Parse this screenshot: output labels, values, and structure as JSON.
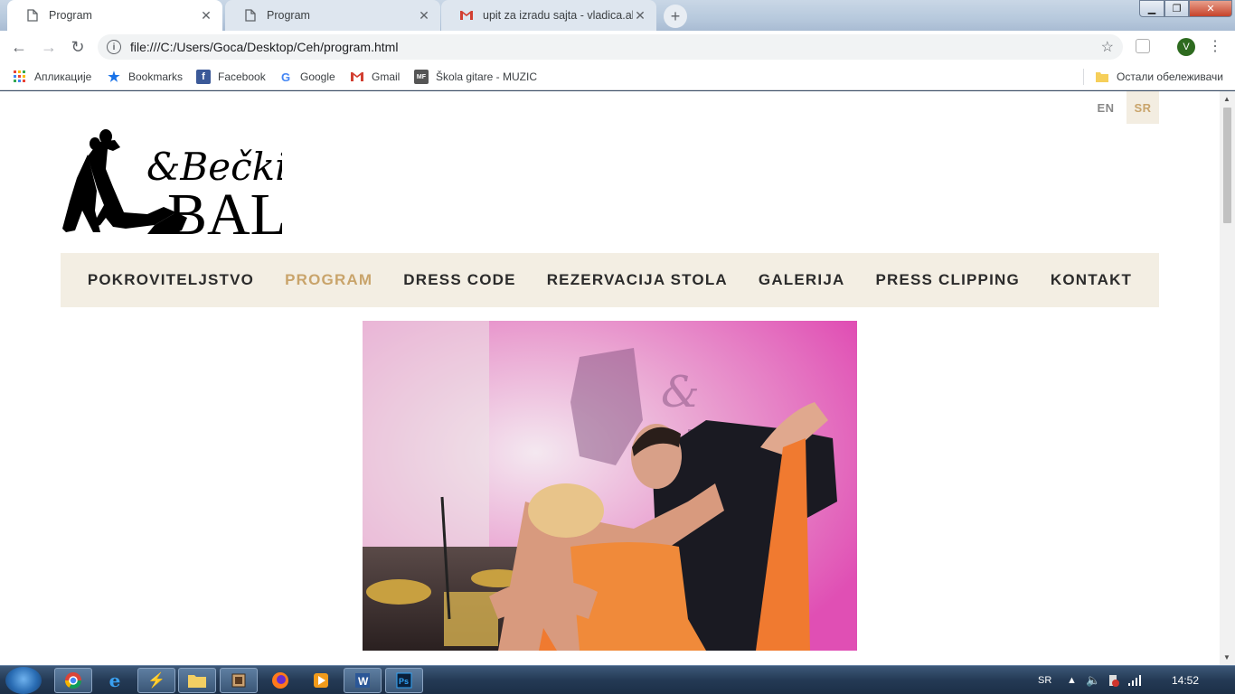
{
  "browser": {
    "tabs": [
      {
        "title": "Program",
        "active": true,
        "icon": "page-icon"
      },
      {
        "title": "Program",
        "active": false,
        "icon": "page-icon"
      },
      {
        "title": "upit za izradu sajta - vladica.aleks",
        "active": false,
        "icon": "gmail-icon"
      }
    ],
    "address": "file:///C:/Users/Goca/Desktop/Ceh/program.html",
    "profile_initial": "V"
  },
  "bookmarks": {
    "items": [
      {
        "label": "Апликације",
        "icon": "apps-grid-icon"
      },
      {
        "label": "Bookmarks",
        "icon": "star-icon"
      },
      {
        "label": "Facebook",
        "icon": "facebook-icon"
      },
      {
        "label": "Google",
        "icon": "google-icon"
      },
      {
        "label": "Gmail",
        "icon": "gmail-icon"
      },
      {
        "label": "Škola gitare - MUZIC",
        "icon": "mf-icon"
      }
    ],
    "other": "Остали обележивачи"
  },
  "site": {
    "lang": {
      "en": "EN",
      "sr": "SR",
      "active": "SR"
    },
    "logo": {
      "line1": "&Bečki",
      "line2": "BAL"
    },
    "nav": [
      {
        "label": "POKROVITELJSTVO",
        "active": false
      },
      {
        "label": "PROGRAM",
        "active": true
      },
      {
        "label": "DRESS CODE",
        "active": false
      },
      {
        "label": "REZERVACIJA STOLA",
        "active": false
      },
      {
        "label": "GALERIJA",
        "active": false
      },
      {
        "label": "PRESS CLIPPING",
        "active": false
      },
      {
        "label": "KONTAKT",
        "active": false
      }
    ],
    "colors": {
      "accent": "#c9a46b",
      "nav_bg": "#f3eee3",
      "text": "#2b2b2b"
    }
  },
  "taskbar": {
    "apps": [
      "chrome-icon",
      "ie-icon",
      "winamp-icon",
      "explorer-icon",
      "notepad-icon",
      "firefox-icon",
      "media-player-icon",
      "word-icon",
      "photoshop-icon"
    ],
    "lang": "SR",
    "time": "14:52"
  }
}
